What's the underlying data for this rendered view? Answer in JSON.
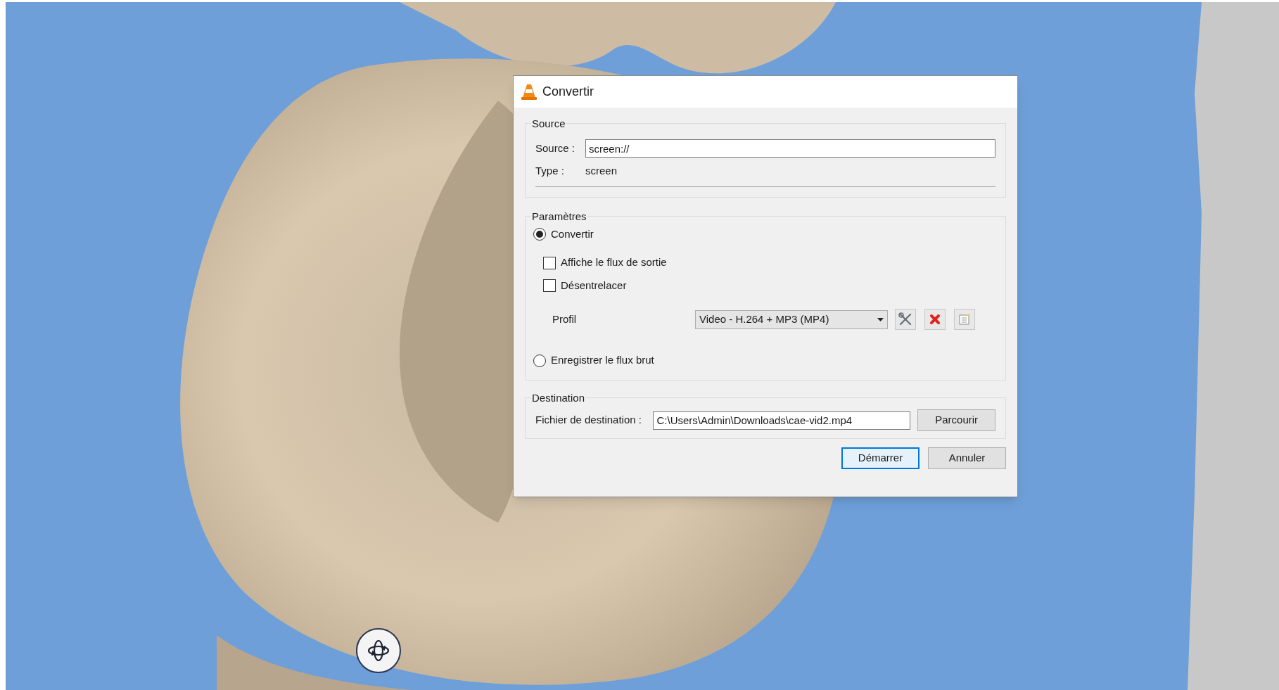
{
  "window": {
    "title": "Convertir"
  },
  "source_group": {
    "title": "Source",
    "source_label": "Source :",
    "source_value": "screen://",
    "type_label": "Type :",
    "type_value": "screen"
  },
  "parameters_group": {
    "title": "Paramètres",
    "modes": [
      {
        "label": "Convertir",
        "selected": true
      },
      {
        "label": "Enregistrer le flux brut",
        "selected": false
      }
    ],
    "checkboxes": [
      {
        "label": "Affiche le flux de sortie",
        "checked": false
      },
      {
        "label": "Désentrelacer",
        "checked": false
      }
    ],
    "profile": {
      "label": "Profil",
      "value": "Video - H.264 + MP3 (MP4)"
    }
  },
  "destination_group": {
    "title": "Destination",
    "label": "Fichier de destination :",
    "value": "C:\\Users\\Admin\\Downloads\\cae-vid2.mp4",
    "browse_button": "Parcourir"
  },
  "buttons": [
    {
      "label": "Démarrer",
      "default": true
    },
    {
      "label": "Annuler",
      "default": false
    }
  ]
}
